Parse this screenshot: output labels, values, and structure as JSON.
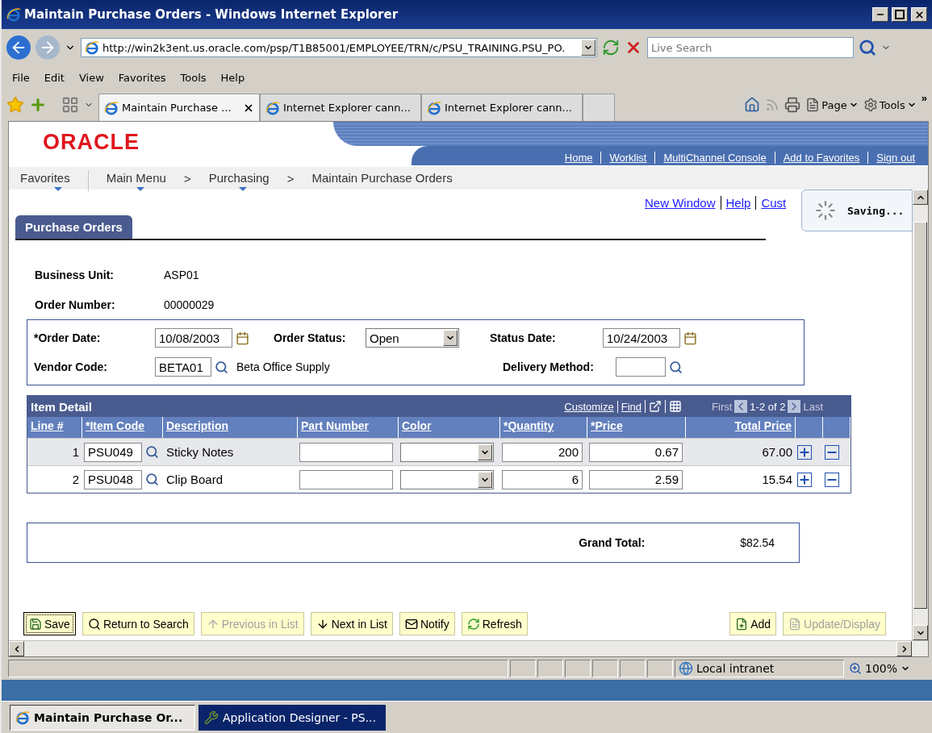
{
  "window": {
    "title": "Maintain Purchase Orders - Windows Internet Explorer"
  },
  "address_bar": {
    "url": "http://win2k3ent.us.oracle.com/psp/T1B85001/EMPLOYEE/TRN/c/PSU_TRAINING.PSU_PO."
  },
  "search": {
    "placeholder": "Live Search"
  },
  "menu": [
    "File",
    "Edit",
    "View",
    "Favorites",
    "Tools",
    "Help"
  ],
  "browser_tabs": [
    {
      "label": "Maintain Purchase ...",
      "selected": true
    },
    {
      "label": "Internet Explorer cann...",
      "selected": false
    },
    {
      "label": "Internet Explorer cann...",
      "selected": false
    }
  ],
  "command_bar": {
    "items": [
      "Page",
      "Tools"
    ],
    "overflow": "»"
  },
  "header": {
    "logo": "ORACLE",
    "links": [
      "Home",
      "Worklist",
      "MultiChannel Console",
      "Add to Favorites",
      "Sign out"
    ]
  },
  "breadcrumb": {
    "separator": ">",
    "items": [
      {
        "label": "Favorites",
        "dropdown": true
      },
      {
        "label": "Main Menu",
        "dropdown": true
      },
      {
        "label": "Purchasing",
        "dropdown": true
      },
      {
        "label": "Maintain Purchase Orders",
        "dropdown": false
      }
    ]
  },
  "page_links": [
    "New Window",
    "Help",
    "Cust"
  ],
  "saving": {
    "text": "Saving..."
  },
  "page_tab": {
    "label": "Purchase Orders",
    "selected": true
  },
  "summary": [
    {
      "label": "Business Unit:",
      "value": "ASP01"
    },
    {
      "label": "Order Number:",
      "value": "00000029"
    }
  ],
  "order_fields": {
    "order_date": {
      "label": "*Order Date:",
      "value": "10/08/2003"
    },
    "order_status": {
      "label": "Order Status:",
      "value": "Open"
    },
    "status_date": {
      "label": "Status Date:",
      "value": "10/24/2003"
    },
    "vendor_code": {
      "label": "Vendor Code:",
      "value": "BETA01",
      "description": "Beta Office Supply"
    },
    "delivery_method": {
      "label": "Delivery Method:"
    }
  },
  "item_detail": {
    "title": "Item Detail",
    "tools": [
      "Customize",
      "Find"
    ],
    "nav": {
      "first": "First",
      "range": "1-2 of 2",
      "last": "Last"
    },
    "columns": [
      "Line #",
      "*Item Code",
      "Description",
      "Part Number",
      "Color",
      "*Quantity",
      "*Price",
      "Total Price"
    ],
    "rows": [
      {
        "line": "1",
        "item_code": "PSU049",
        "description": "Sticky Notes",
        "quantity": "200",
        "price": "0.67",
        "total_price": "67.00"
      },
      {
        "line": "2",
        "item_code": "PSU048",
        "description": "Clip Board",
        "quantity": "6",
        "price": "2.59",
        "total_price": "15.54"
      }
    ]
  },
  "grand_total": {
    "label": "Grand Total:",
    "value": "$82.54"
  },
  "buttons_left": [
    {
      "label": "Save",
      "kind": "save",
      "disabled": false,
      "focused": true
    },
    {
      "label": "Return to Search",
      "kind": "search",
      "disabled": false,
      "focused": false
    },
    {
      "label": "Previous in List",
      "kind": "previous",
      "disabled": true,
      "focused": false
    },
    {
      "label": "Next in List",
      "kind": "next",
      "disabled": false,
      "focused": false
    },
    {
      "label": "Notify",
      "kind": "notify",
      "disabled": false,
      "focused": false
    },
    {
      "label": "Refresh",
      "kind": "refresh",
      "disabled": false,
      "focused": false
    }
  ],
  "buttons_right": [
    {
      "label": "Add",
      "kind": "add",
      "disabled": false,
      "focused": false
    },
    {
      "label": "Update/Display",
      "kind": "update",
      "disabled": true,
      "focused": false
    }
  ],
  "status_bar": {
    "zone": "Local intranet",
    "zoom": "100%"
  },
  "taskbar": [
    {
      "label": "Maintain Purchase Or...",
      "selected": true
    },
    {
      "label": "Application Designer - PS...",
      "selected": false
    }
  ]
}
